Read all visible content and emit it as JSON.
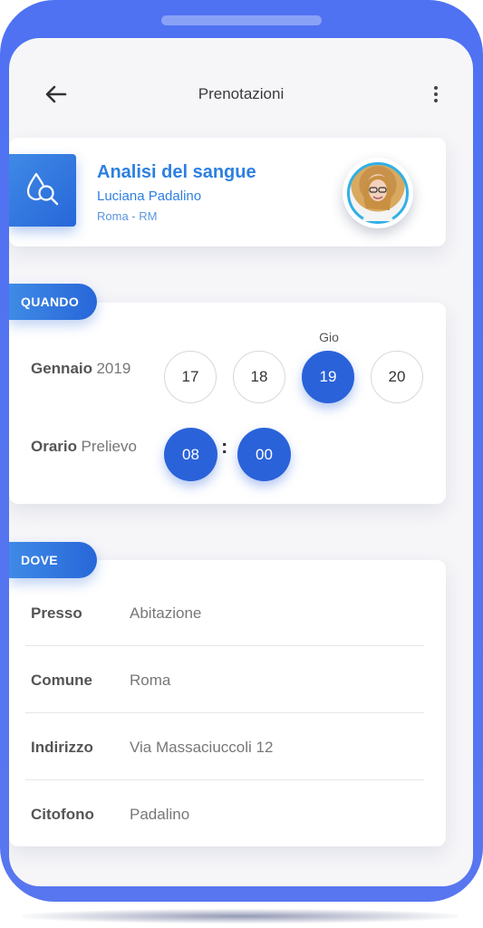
{
  "header": {
    "title": "Prenotazioni"
  },
  "service": {
    "title": "Analisi del sangue",
    "person": "Luciana Padalino",
    "location": "Roma - RM"
  },
  "quando": {
    "tag": "QUANDO",
    "selected_day_name": "Gio",
    "month": "Gennaio",
    "year": "2019",
    "dates": [
      "17",
      "18",
      "19",
      "20"
    ],
    "selected_date": "19",
    "time_label_strong": "Orario",
    "time_label_light": "Prelievo",
    "hour": "08",
    "separator": ":",
    "minute": "00"
  },
  "dove": {
    "tag": "DOVE",
    "rows": [
      {
        "key": "Presso",
        "value": "Abitazione"
      },
      {
        "key": "Comune",
        "value": "Roma"
      },
      {
        "key": "Indirizzo",
        "value": "Via Massaciuccoli 12"
      },
      {
        "key": "Citofono",
        "value": "Padalino"
      }
    ]
  },
  "colors": {
    "phone_frame": "#5576f0",
    "accent_blue": "#2a62d9",
    "title_blue": "#2d7fe0",
    "screen_bg": "#f6f6f9"
  },
  "icons": {
    "back": "arrow-left-icon",
    "menu": "more-vertical-icon",
    "service": "blood-drop-search-icon"
  }
}
